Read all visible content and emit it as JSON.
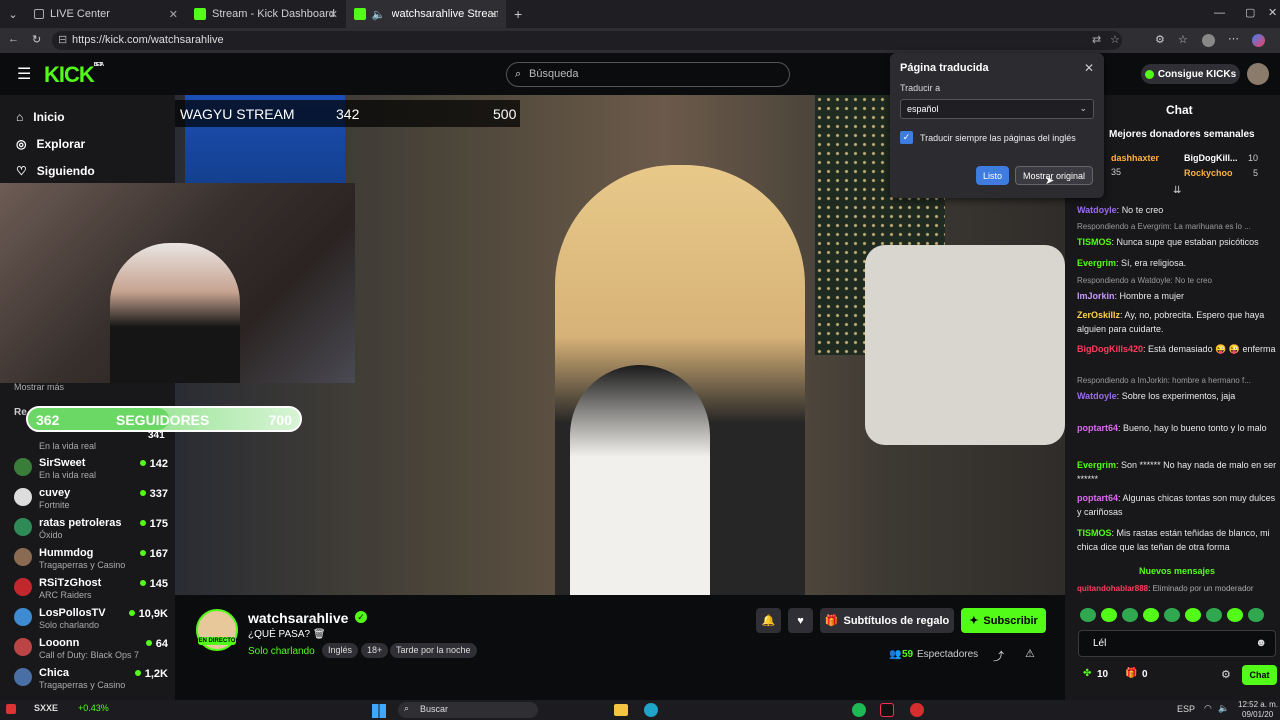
{
  "browser": {
    "tabs": [
      {
        "title": "LIVE Center"
      },
      {
        "title": "Stream - Kick Dashboard"
      },
      {
        "title": "watchsarahlive Stream - Watc"
      }
    ],
    "url": "https://kick.com/watchsarahlive"
  },
  "header": {
    "logo": "KICK",
    "logo_beta": "BETA",
    "search_placeholder": "Búsqueda"
  },
  "sidebar": {
    "nav": [
      {
        "label": "Inicio"
      },
      {
        "label": "Explorar"
      },
      {
        "label": "Siguiendo"
      }
    ],
    "show_more": "Mostrar más",
    "section_label": "Re",
    "followed": [
      {
        "name": "SirSweet",
        "category": "En la vida real",
        "viewers": "142"
      },
      {
        "name": "cuvey",
        "category": "Fortnite",
        "viewers": "337"
      },
      {
        "name": "ratas petroleras",
        "category": "Óxido",
        "viewers": "175"
      },
      {
        "name": "Hummdog",
        "category": "Tragaperras y Casino",
        "viewers": "167"
      },
      {
        "name": "RSiTzGhost",
        "category": "ARC Raiders",
        "viewers": "145"
      },
      {
        "name": "LosPollosTV",
        "category": "Solo charlando",
        "viewers": "10,9K"
      },
      {
        "name": "Looonn",
        "category": "Call of Duty: Black Ops 7",
        "viewers": "64"
      },
      {
        "name": "Chica",
        "category": "Tragaperras y Casino",
        "viewers": "1,2K"
      }
    ],
    "partial_top": {
      "category": "En la vida real",
      "viewers": "341"
    }
  },
  "overlay": {
    "goal_title": "WAGYU STREAM",
    "goal_current": "342",
    "goal_target": "500",
    "followers_current": "362",
    "followers_label": "SEGUIDORES",
    "followers_target": "700",
    "followers_progress": 0.517
  },
  "stream": {
    "channel": "watchsarahlive",
    "title": "¿QUÉ PASA? 🗑",
    "live_badge": "EN DIRECTO",
    "category": "Solo charlando",
    "tags": [
      "Inglés",
      "18+",
      "Tarde por la noche"
    ],
    "viewers_count": "59",
    "viewers_label": "Espectadores",
    "gift_subs_label": "Subtítulos de regalo",
    "subscribe_label": "Subscribir"
  },
  "translate_popup": {
    "title": "Página traducida",
    "translate_to_label": "Traducir a",
    "language": "español",
    "always_translate": "Traducir siempre las páginas del inglés",
    "done_label": "Listo",
    "show_original_label": "Mostrar original"
  },
  "chat": {
    "get_kicks": "Consigue KICKs",
    "title": "Chat",
    "top_donors_label": "Mejores donadores semanales",
    "donors": [
      {
        "name": "dashhaxter",
        "amount": "35"
      },
      {
        "name": "BigDogKill...",
        "amount": "10"
      },
      {
        "name": "Rockychoo",
        "amount": "5"
      }
    ],
    "messages": [
      {
        "reply": "",
        "user": "Watdoyle",
        "text": "No te creo",
        "color": "#9b6bf0"
      },
      {
        "reply": "Respondiendo a Evergrim: La marihuana es lo ...",
        "user": "TISMOS",
        "text": "Nunca supe que estaban psicóticos",
        "color": "#53fc18"
      },
      {
        "reply": "",
        "user": "Evergrim",
        "text": "Sí, era religiosa.",
        "color": "#53fc18"
      },
      {
        "reply": "Respondiendo a Watdoyle: No te creo",
        "user": "ImJorkin",
        "text": "Hombre a mujer",
        "color": "#c79af6"
      },
      {
        "reply": "",
        "user": "ZerOskillz",
        "text": "Ay, no, pobrecita. Espero que haya alguien para cuidarte.",
        "color": "#ffd24d"
      },
      {
        "reply": "",
        "user": "BigDogKills420",
        "text": "Está demasiado 😜 😜 enferma",
        "color": "#ff3b5c"
      },
      {
        "reply": "Respondiendo a ImJorkin: hombre a hermano f...",
        "user": "Watdoyle",
        "text": "Sobre los experimentos, jaja",
        "color": "#9b6bf0"
      },
      {
        "reply": "",
        "user": "poptart64",
        "text": "Bueno, hay lo bueno tonto y lo malo",
        "color": "#d96bf0"
      },
      {
        "reply": "",
        "user": "Evergrim",
        "text": "Son ****** No hay nada de malo en ser ******",
        "color": "#53fc18"
      },
      {
        "reply": "",
        "user": "poptart64",
        "text": "Algunas chicas tontas son muy dulces y cariñosas",
        "color": "#d96bf0"
      },
      {
        "reply": "",
        "user": "TISMOS",
        "text": "Mis rastas están teñidas de blanco, mi chica dice que las teñan de otra forma",
        "color": "#53fc18"
      }
    ],
    "new_messages": "Nuevos mensajes",
    "moderated_user": "quitandohablar888",
    "moderated_text": "Eliminado por un moderador",
    "input_value": "Lél",
    "kicks_count": "10",
    "gift_count": "0",
    "send_label": "Chat"
  },
  "taskbar": {
    "ticker": "SXXE",
    "ticker_change": "+0.43%",
    "search_label": "Buscar",
    "lang": "ESP",
    "time": "12:52 a. m.",
    "date": "09/01/20"
  }
}
